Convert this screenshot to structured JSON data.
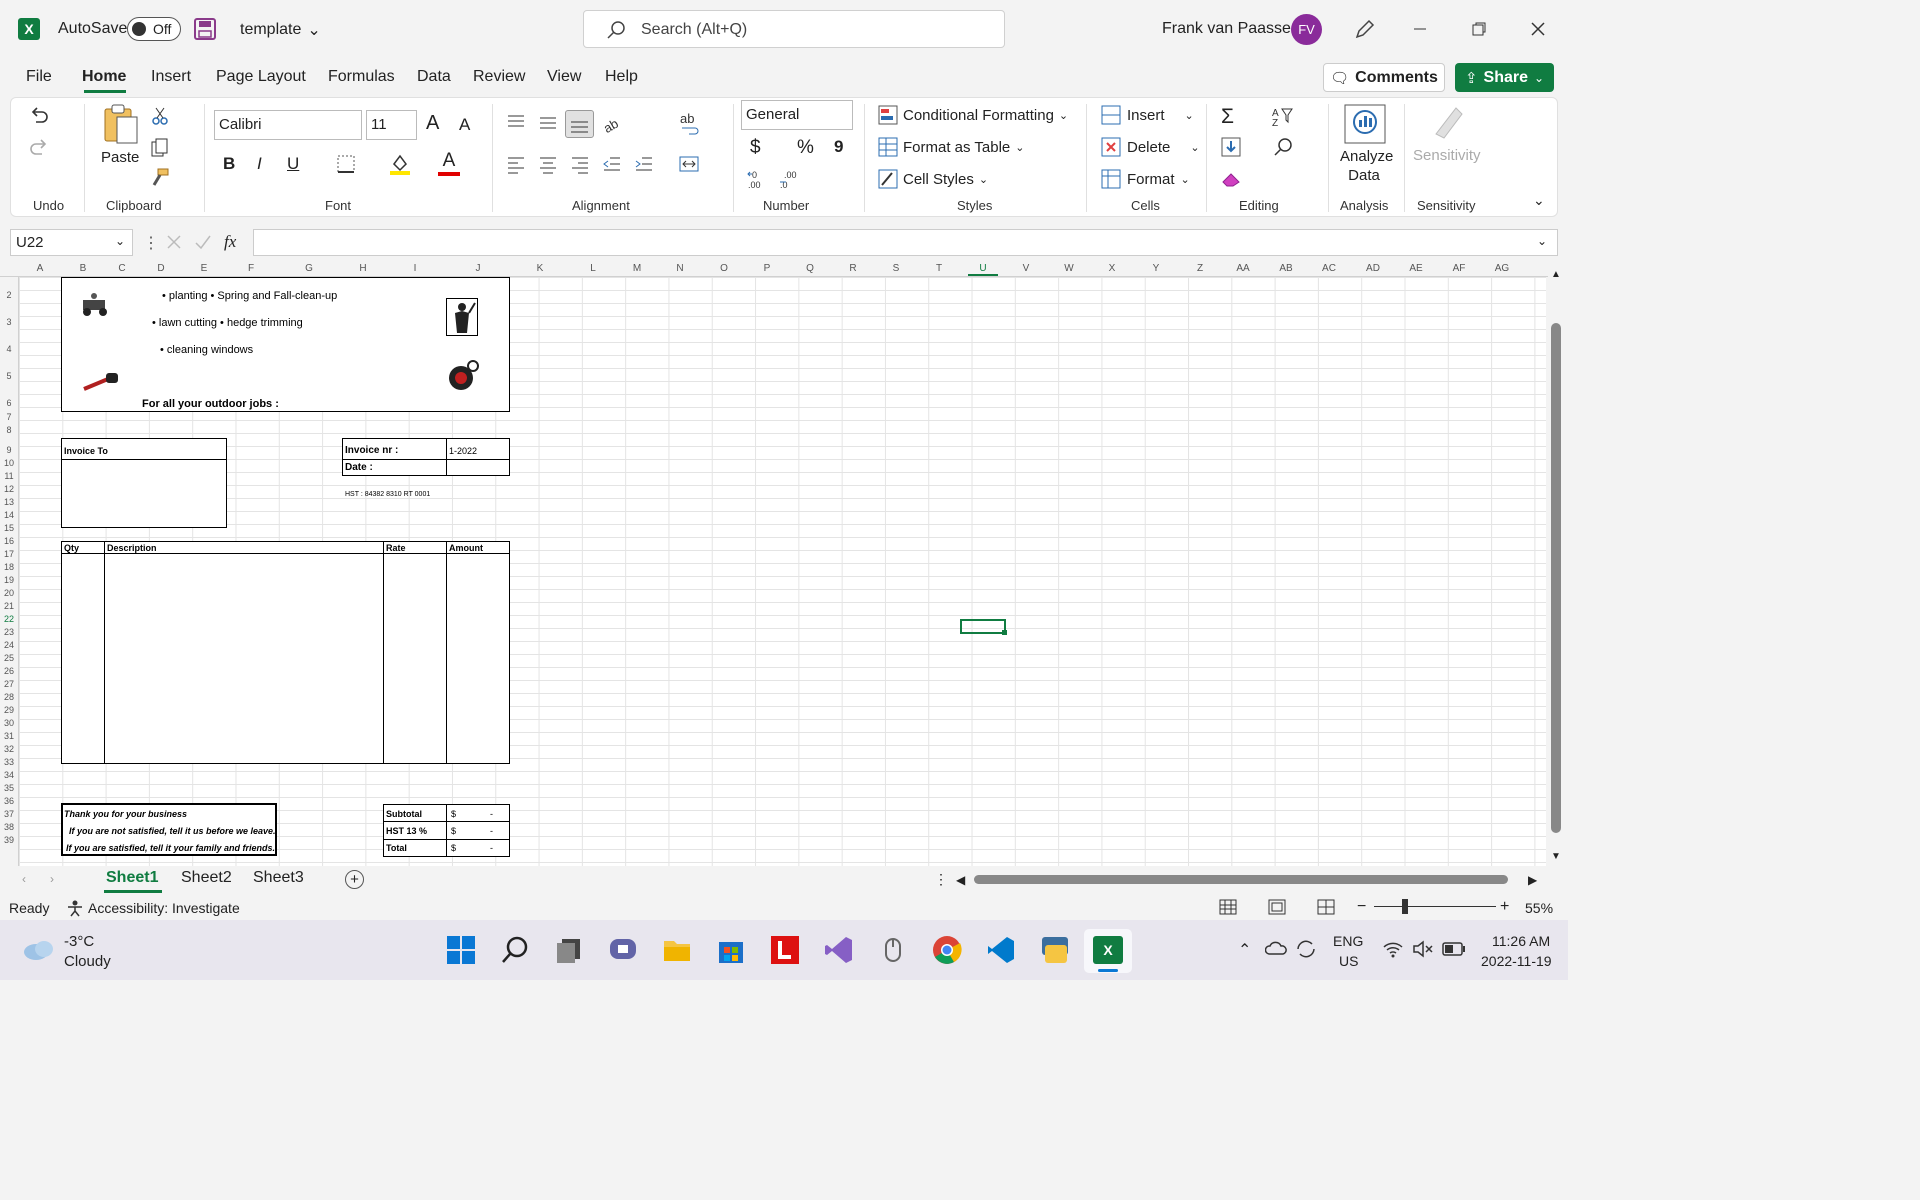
{
  "titlebar": {
    "autosave_label": "AutoSave",
    "autosave_state": "Off",
    "filename": "template",
    "search_placeholder": "Search (Alt+Q)",
    "user_name": "Frank van Paassen",
    "user_initials": "FV"
  },
  "menu": {
    "items": [
      "File",
      "Home",
      "Insert",
      "Page Layout",
      "Formulas",
      "Data",
      "Review",
      "View",
      "Help"
    ],
    "comments": "Comments",
    "share": "Share"
  },
  "ribbon": {
    "undo_group": "Undo",
    "clipboard_group": "Clipboard",
    "paste": "Paste",
    "font_group": "Font",
    "font_name": "Calibri",
    "font_size": "11",
    "alignment_group": "Alignment",
    "number_group": "Number",
    "number_format": "General",
    "styles_group": "Styles",
    "conditional_formatting": "Conditional Formatting",
    "format_as_table": "Format as Table",
    "cell_styles": "Cell Styles",
    "cells_group": "Cells",
    "insert": "Insert",
    "delete": "Delete",
    "format": "Format",
    "editing_group": "Editing",
    "analyze_line1": "Analyze",
    "analyze_line2": "Data",
    "analysis_group": "Analysis",
    "sensitivity": "Sensitivity",
    "sensitivity_group": "Sensitivity",
    "bold": "B",
    "italic": "I",
    "underline": "U",
    "grow_font": "A",
    "shrink_font": "A",
    "font_color": "A",
    "currency": "$",
    "percent": "%",
    "comma": "9"
  },
  "formula_bar": {
    "name_box": "U22",
    "fx": "fx",
    "content": ""
  },
  "grid": {
    "columns": [
      "A",
      "B",
      "C",
      "D",
      "E",
      "F",
      "G",
      "H",
      "I",
      "J",
      "K",
      "L",
      "M",
      "N",
      "O",
      "P",
      "Q",
      "R",
      "S",
      "T",
      "U",
      "V",
      "W",
      "X",
      "Y",
      "Z",
      "AA",
      "AB",
      "AC",
      "AD",
      "AE",
      "AF",
      "AG"
    ],
    "rows": [
      "2",
      "3",
      "4",
      "5",
      "6",
      "7",
      "8",
      "9",
      "10",
      "11",
      "12",
      "13",
      "14",
      "15",
      "16",
      "17",
      "18",
      "19",
      "20",
      "21",
      "22",
      "23",
      "24",
      "25",
      "26",
      "27",
      "28",
      "29",
      "30",
      "31",
      "32",
      "33",
      "34",
      "35",
      "36",
      "37",
      "38",
      "39"
    ],
    "selected_cell": "U22"
  },
  "invoice": {
    "services_line1": "•  planting  • Spring and Fall-clean-up",
    "services_line2": "•  lawn cutting  •  hedge trimming",
    "services_line3": "•  cleaning windows",
    "tagline": "For all your outdoor jobs :",
    "invoice_to": "Invoice To",
    "invoice_nr_label": "Invoice nr :",
    "invoice_nr_value": "1-2022",
    "date_label": "Date :",
    "hst_number": "HST : 84382 8310 RT 0001",
    "col_qty": "Qty",
    "col_description": "Description",
    "col_rate": "Rate",
    "col_amount": "Amount",
    "thanks_line1": "Thank you for your business",
    "thanks_line2": "If you are not satisfied, tell it us before we leave.",
    "thanks_line3": "If you are satisfied, tell it your family and friends.",
    "subtotal_label": "Subtotal",
    "hst_label": "HST 13 %",
    "total_label": "Total",
    "currency_symbol": "$",
    "dash": "-"
  },
  "sheets": {
    "tabs": [
      "Sheet1",
      "Sheet2",
      "Sheet3"
    ],
    "active": "Sheet1"
  },
  "status": {
    "ready": "Ready",
    "accessibility": "Accessibility: Investigate",
    "zoom": "55%"
  },
  "taskbar": {
    "temperature": "-3°C",
    "weather": "Cloudy",
    "language": "ENG",
    "region": "US",
    "time": "11:26 AM",
    "date": "2022-11-19"
  }
}
